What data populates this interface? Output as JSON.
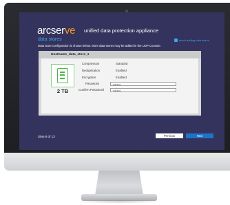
{
  "brand": {
    "logo_main": "arcser",
    "logo_accent": "ve",
    "app_title": "unified data protection appliance"
  },
  "page": {
    "section_title": "data stores",
    "about_link": "about adding data stores",
    "description": "Data store configuration is shown below. More data stores may be added in the UDP Console."
  },
  "data_store": {
    "name": "Hostname_data_store_1",
    "capacity": "2 TB",
    "icon": "disk-icon",
    "properties": [
      {
        "label": "Compression",
        "value": "Standard"
      },
      {
        "label": "Deduplication",
        "value": "Enabled"
      },
      {
        "label": "Encryption",
        "value": "Enabled"
      }
    ],
    "password_label": "Password",
    "password_value": "••••••••",
    "confirm_label": "Confirm Password",
    "confirm_value": "••••••••"
  },
  "footer": {
    "step": "Step 6 of 13",
    "previous": "Previous",
    "next": "Next"
  },
  "colors": {
    "screen_bg": "#34335d",
    "accent_blue": "#3fa6e8",
    "brand_orange": "#f29a24",
    "next_button": "#1d74c6",
    "disk_green": "#4fb34a"
  }
}
